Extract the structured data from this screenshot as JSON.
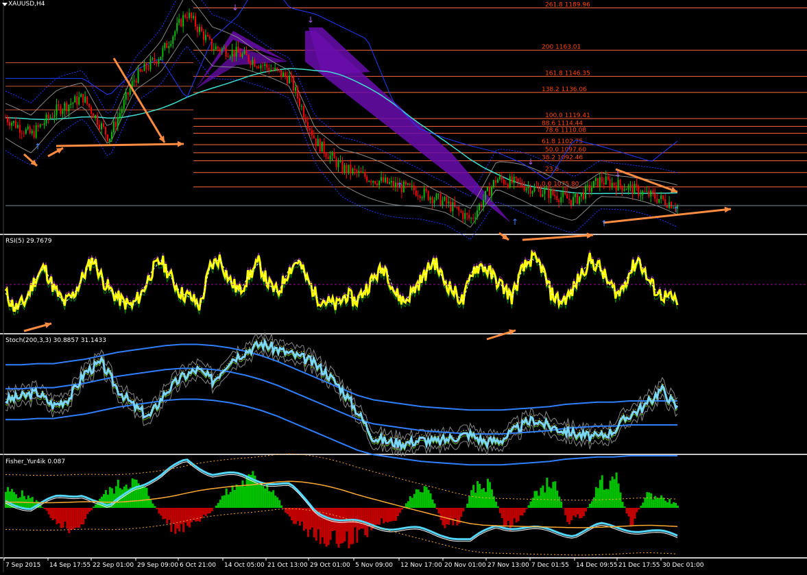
{
  "colors": {
    "background": "#000000",
    "separator": "#c8c8c8",
    "fib_line": "#ff6a3d",
    "fib_text": "#ff4500",
    "candle_up": "#00c000",
    "candle_down": "#ff0000",
    "bands": "#8a8a8a",
    "ma": "#40e0d0",
    "envelope": "#1e3cff",
    "annotation": "#ff8c40",
    "purple_fill": "#6a0dad",
    "rsi": "#ffff00",
    "stoch_main": "#7ad7ff",
    "stoch_slow": "#2f7fff",
    "fisher_pos": "#00c000",
    "fisher_neg": "#c00000",
    "fisher_line": "#54d8ff",
    "fisher_signal": "#ffaa33",
    "text": "#ffffff"
  },
  "panels": {
    "price": {
      "label": "XAUUSD,H4"
    },
    "rsi": {
      "label": "RSI(5) 29.7679"
    },
    "stoch": {
      "label": "Stoch(200,3,3) 30.8857 31.1433"
    },
    "fisher": {
      "label": "Fisher_Yur4ik 0.087"
    }
  },
  "chart_data": [
    {
      "type": "line",
      "panel": "price",
      "title": "XAUUSD,H4",
      "x_dates": [
        "7 Sep 2015",
        "14 Sep 17:55",
        "22 Sep 01:00",
        "29 Sep 09:00",
        "6 Oct 21:00",
        "14 Oct 05:00",
        "21 Oct 13:00",
        "29 Oct 01:00",
        "5 Nov 09:00",
        "12 Nov 17:00",
        "20 Nov 01:00",
        "27 Nov 13:00",
        "7 Dec 01:55",
        "14 Dec 09:55",
        "21 Dec 17:55",
        "30 Dec 01:00"
      ],
      "series": [
        {
          "values": [
            1120,
            1109,
            1125,
            1133,
            1107,
            1145,
            1160,
            1187,
            1165,
            1161,
            1153,
            1145,
            1105,
            1088,
            1082,
            1077,
            1073,
            1066,
            1055,
            1081,
            1077,
            1072,
            1067,
            1080,
            1076,
            1070,
            1064
          ]
        }
      ],
      "fibonacci_levels": [
        {
          "label": "261.8  1189.96",
          "price": 1189.96
        },
        {
          "label": "200  1163.01",
          "price": 1163.01
        },
        {
          "label": "161.8  1146.35",
          "price": 1146.35
        },
        {
          "label": "138.2  1136.06",
          "price": 1136.06
        },
        {
          "label": "100.0  1119.41",
          "price": 1119.41
        },
        {
          "label": "88.6  1114.44",
          "price": 1114.44
        },
        {
          "label": "78.6  1110.08",
          "price": 1110.08
        },
        {
          "label": "61.8  1102.75",
          "price": 1102.75
        },
        {
          "label": "50.0  1097.60",
          "price": 1097.6
        },
        {
          "label": "38.2  1092.46",
          "price": 1092.46
        },
        {
          "label": "23.6",
          "price": 1085.0
        },
        {
          "label": "0.0  1075.80",
          "price": 1075.8
        }
      ],
      "ylim": [
        1046,
        1195
      ]
    },
    {
      "type": "line",
      "panel": "rsi",
      "title": "RSI(5) 29.7679",
      "series": [
        {
          "values": [
            40,
            22,
            30,
            55,
            70,
            45,
            28,
            38,
            60,
            80,
            55,
            40,
            30,
            25,
            40,
            65,
            78,
            58,
            40,
            35,
            25,
            70,
            80,
            55,
            42,
            60,
            75,
            50,
            40,
            65,
            78,
            55,
            35,
            30,
            25,
            38,
            30,
            45,
            60,
            70,
            40,
            30,
            45,
            60,
            78,
            55,
            42,
            30,
            68,
            72,
            60,
            48,
            35,
            65,
            80,
            72,
            40,
            30,
            38,
            60,
            78,
            70,
            50,
            38,
            62,
            80,
            55,
            40,
            35,
            30
          ]
        }
      ],
      "ylim": [
        0,
        100
      ]
    },
    {
      "type": "line",
      "panel": "stoch",
      "title": "Stoch(200,3,3) 30.8857 31.1433",
      "series": [
        {
          "values": [
            45,
            48,
            52,
            40,
            47,
            70,
            78,
            55,
            40,
            30,
            52,
            65,
            72,
            62,
            80,
            88,
            95,
            90,
            85,
            80,
            70,
            55,
            35,
            12,
            8,
            7,
            10,
            8,
            12,
            15,
            8,
            10,
            20,
            28,
            22,
            18,
            14,
            12,
            18,
            32,
            40,
            55,
            38
          ]
        },
        {
          "values": [
            55,
            55,
            56,
            56,
            58,
            60,
            63,
            66,
            68,
            70,
            72,
            73,
            73,
            72,
            70,
            67,
            63,
            58,
            52,
            46,
            40,
            34,
            28,
            24,
            22,
            20,
            18,
            17,
            16,
            15,
            15,
            15,
            16,
            17,
            18,
            20,
            21,
            22,
            22,
            23,
            23,
            23,
            23
          ]
        }
      ],
      "ylim": [
        0,
        100
      ]
    },
    {
      "type": "bar",
      "panel": "fisher",
      "title": "Fisher_Yur4ik 0.087",
      "series": [
        {
          "values": [
            0.5,
            0.4,
            0.2,
            -0.3,
            -0.6,
            -0.4,
            0.3,
            0.6,
            0.8,
            0.5,
            -0.3,
            -0.7,
            -0.5,
            -0.2,
            0.4,
            0.7,
            0.9,
            0.6,
            -0.2,
            -0.6,
            -0.8,
            -1.0,
            -0.9,
            -0.7,
            -0.4,
            -0.3,
            0.4,
            0.6,
            -0.5,
            -0.4,
            0.6,
            0.7,
            -0.6,
            -0.3,
            0.5,
            0.8,
            -0.4,
            -0.2,
            0.7,
            0.9,
            -0.5,
            0.4,
            0.3,
            0.087
          ]
        }
      ]
    }
  ]
}
